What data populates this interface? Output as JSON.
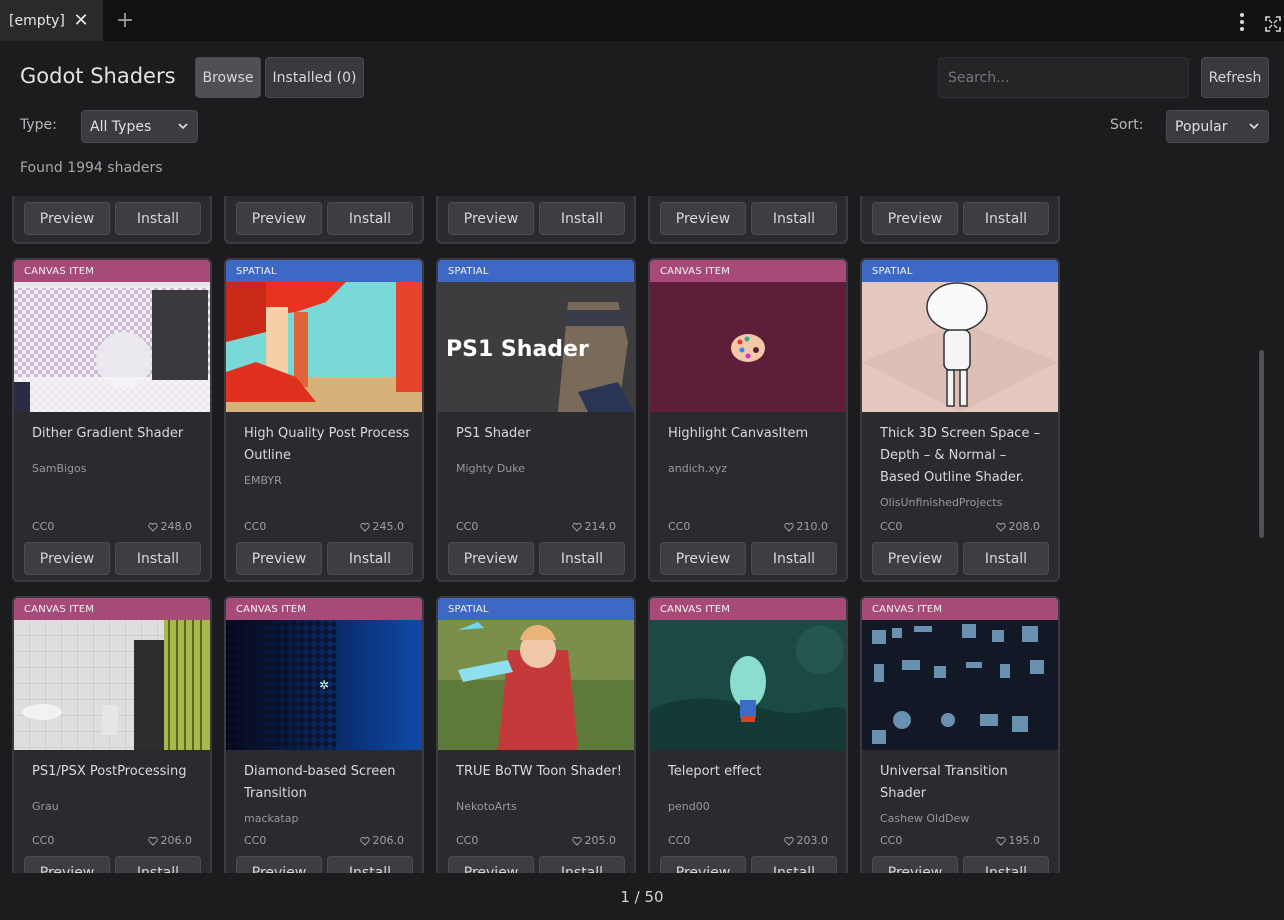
{
  "tab": {
    "label": "[empty]"
  },
  "header": {
    "title": "Godot Shaders",
    "browse_label": "Browse",
    "installed_label": "Installed (0)",
    "search_placeholder": "Search...",
    "refresh_label": "Refresh"
  },
  "filters": {
    "type_label": "Type:",
    "type_value": "All Types",
    "sort_label": "Sort:",
    "sort_value": "Popular"
  },
  "status": {
    "found": "Found 1994 shaders"
  },
  "card_buttons": {
    "preview": "Preview",
    "install": "Install"
  },
  "rows": [
    {
      "cards": [
        {
          "badge": "CANVAS ITEM",
          "kind": "canvas",
          "thumb": "dither",
          "title": "Dither Gradient Shader",
          "title_lines": 1,
          "author": "SamBigos",
          "license": "CC0",
          "likes": "248.0"
        },
        {
          "badge": "SPATIAL",
          "kind": "spatial",
          "thumb": "red-ruins",
          "title": "High Quality Post Process Outline",
          "title_lines": 2,
          "author": "EMBYR",
          "license": "CC0",
          "likes": "245.0"
        },
        {
          "badge": "SPATIAL",
          "kind": "spatial",
          "thumb": "ps1",
          "thumb_text": "PS1 Shader",
          "title": "PS1 Shader",
          "title_lines": 1,
          "author": "Mighty Duke",
          "license": "CC0",
          "likes": "214.0"
        },
        {
          "badge": "CANVAS ITEM",
          "kind": "canvas",
          "thumb": "palette",
          "title": "Highlight CanvasItem",
          "title_lines": 1,
          "author": "andich.xyz",
          "license": "CC0",
          "likes": "210.0"
        },
        {
          "badge": "SPATIAL",
          "kind": "spatial",
          "thumb": "outline-figure",
          "title": "Thick 3D Screen Space – Depth – & Normal – Based Outline Shader.",
          "title_lines": 3,
          "author": "OlisUnfinishedProjects",
          "license": "CC0",
          "likes": "208.0"
        }
      ]
    },
    {
      "cards": [
        {
          "badge": "CANVAS ITEM",
          "kind": "canvas",
          "thumb": "bathroom",
          "title": "PS1/PSX PostProcessing",
          "title_lines": 1,
          "author": "Grau",
          "license": "CC0",
          "likes": "206.0"
        },
        {
          "badge": "CANVAS ITEM",
          "kind": "canvas",
          "thumb": "diamond",
          "title": "Diamond-based Screen Transition",
          "title_lines": 2,
          "author": "mackatap",
          "license": "CC0",
          "likes": "206.0"
        },
        {
          "badge": "SPATIAL",
          "kind": "spatial",
          "thumb": "toon",
          "title": "TRUE BoTW Toon Shader!",
          "title_lines": 1,
          "author": "NekotoArts",
          "license": "CC0",
          "likes": "205.0"
        },
        {
          "badge": "CANVAS ITEM",
          "kind": "canvas",
          "thumb": "teleport",
          "title": "Teleport effect",
          "title_lines": 1,
          "author": "pend00",
          "license": "CC0",
          "likes": "203.0"
        },
        {
          "badge": "CANVAS ITEM",
          "kind": "canvas",
          "thumb": "transition",
          "title": "Universal Transition Shader",
          "title_lines": 2,
          "author": "Cashew OldDew",
          "license": "CC0",
          "likes": "195.0"
        }
      ]
    }
  ],
  "pager": {
    "label": "1 / 50"
  },
  "icons": {
    "tab_close": "close-icon",
    "tab_add": "plus-icon",
    "menu": "kebab-menu-icon",
    "fullscreen": "fullscreen-icon",
    "chevron": "chevron-down-icon",
    "like": "heart-icon"
  },
  "colors": {
    "canvas_badge": "#a84a78",
    "spatial_badge": "#3e68c6",
    "background": "#1c1c1f"
  }
}
